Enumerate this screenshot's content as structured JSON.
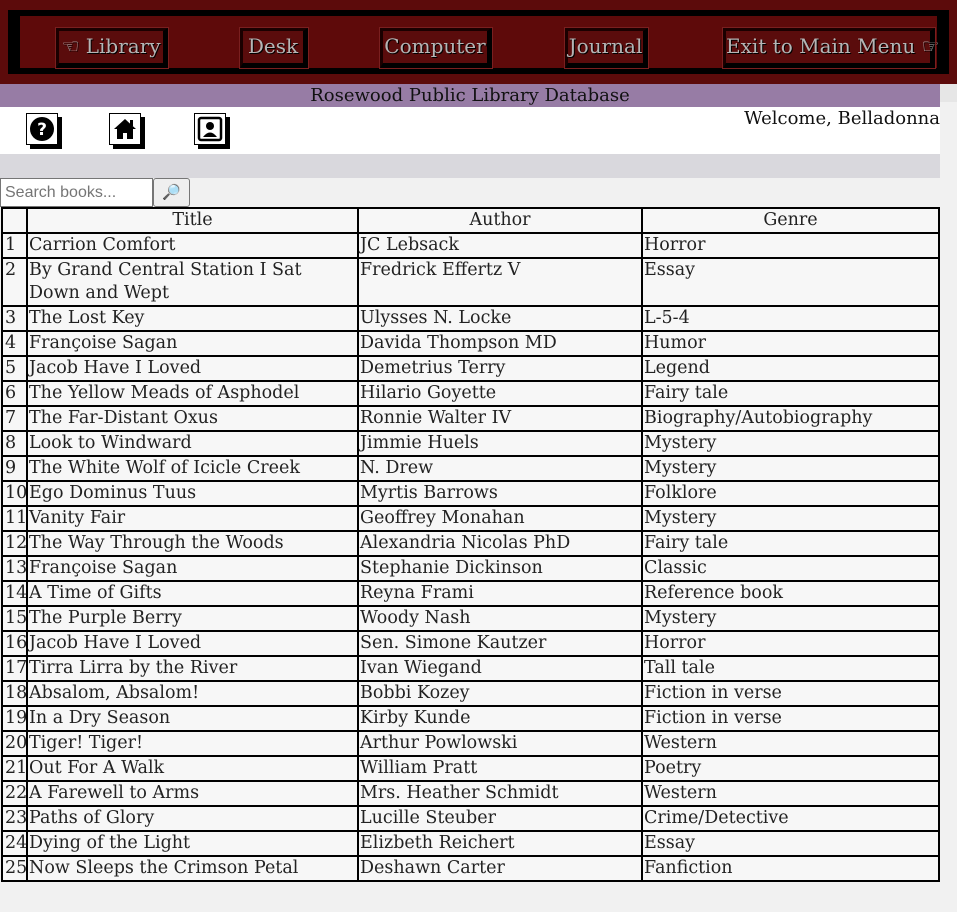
{
  "nav": {
    "items": [
      {
        "label": "☜ Library"
      },
      {
        "label": "Desk"
      },
      {
        "label": "Computer"
      },
      {
        "label": "Journal"
      },
      {
        "label": "Exit to Main Menu ☞"
      }
    ]
  },
  "header": {
    "title": "Rosewood Public Library Database",
    "welcome": "Welcome, Belladonna"
  },
  "icons": {
    "help": "question-icon",
    "home": "home-icon",
    "profile": "contact-card-icon"
  },
  "search": {
    "placeholder": "Search books...",
    "value": "",
    "button_icon": "🔎"
  },
  "table": {
    "headers": {
      "num": "",
      "title": "Title",
      "author": "Author",
      "genre": "Genre"
    },
    "rows": [
      {
        "num": "1",
        "title": "Carrion Comfort",
        "author": "JC Lebsack",
        "genre": "Horror"
      },
      {
        "num": "2",
        "title": "By Grand Central Station I Sat Down and Wept",
        "author": "Fredrick Effertz V",
        "genre": "Essay"
      },
      {
        "num": "3",
        "title": "The Lost Key",
        "author": "Ulysses N. Locke",
        "genre": "L-5-4"
      },
      {
        "num": "4",
        "title": "Françoise Sagan",
        "author": "Davida Thompson MD",
        "genre": "Humor"
      },
      {
        "num": "5",
        "title": "Jacob Have I Loved",
        "author": "Demetrius Terry",
        "genre": "Legend"
      },
      {
        "num": "6",
        "title": "The Yellow Meads of Asphodel",
        "author": "Hilario Goyette",
        "genre": "Fairy tale"
      },
      {
        "num": "7",
        "title": "The Far-Distant Oxus",
        "author": "Ronnie Walter IV",
        "genre": "Biography/Autobiography"
      },
      {
        "num": "8",
        "title": "Look to Windward",
        "author": "Jimmie Huels",
        "genre": "Mystery"
      },
      {
        "num": "9",
        "title": "The White Wolf of Icicle Creek",
        "author": "N. Drew",
        "genre": "Mystery"
      },
      {
        "num": "10",
        "title": "Ego Dominus Tuus",
        "author": "Myrtis Barrows",
        "genre": "Folklore"
      },
      {
        "num": "11",
        "title": "Vanity Fair",
        "author": "Geoffrey Monahan",
        "genre": "Mystery"
      },
      {
        "num": "12",
        "title": "The Way Through the Woods",
        "author": "Alexandria Nicolas PhD",
        "genre": "Fairy tale"
      },
      {
        "num": "13",
        "title": "Françoise Sagan",
        "author": "Stephanie Dickinson",
        "genre": "Classic"
      },
      {
        "num": "14",
        "title": "A Time of Gifts",
        "author": "Reyna Frami",
        "genre": "Reference book"
      },
      {
        "num": "15",
        "title": "The Purple Berry",
        "author": "Woody Nash",
        "genre": "Mystery"
      },
      {
        "num": "16",
        "title": "Jacob Have I Loved",
        "author": "Sen. Simone Kautzer",
        "genre": "Horror"
      },
      {
        "num": "17",
        "title": "Tirra Lirra by the River",
        "author": "Ivan Wiegand",
        "genre": "Tall tale"
      },
      {
        "num": "18",
        "title": "Absalom, Absalom!",
        "author": "Bobbi Kozey",
        "genre": "Fiction in verse"
      },
      {
        "num": "19",
        "title": "In a Dry Season",
        "author": "Kirby Kunde",
        "genre": "Fiction in verse"
      },
      {
        "num": "20",
        "title": "Tiger! Tiger!",
        "author": "Arthur Powlowski",
        "genre": "Western"
      },
      {
        "num": "21",
        "title": "Out For A Walk",
        "author": "William Pratt",
        "genre": "Poetry"
      },
      {
        "num": "22",
        "title": "A Farewell to Arms",
        "author": "Mrs. Heather Schmidt",
        "genre": "Western"
      },
      {
        "num": "23",
        "title": "Paths of Glory",
        "author": "Lucille Steuber",
        "genre": "Crime/Detective"
      },
      {
        "num": "24",
        "title": "Dying of the Light",
        "author": "Elizbeth Reichert",
        "genre": "Essay"
      },
      {
        "num": "25",
        "title": "Now Sleeps the Crimson Petal",
        "author": "Deshawn Carter",
        "genre": "Fanfiction"
      }
    ]
  },
  "colors": {
    "nav_bg": "#5c0b0b",
    "title_bar": "#977ca5",
    "grey_band": "#d9d8dd"
  }
}
